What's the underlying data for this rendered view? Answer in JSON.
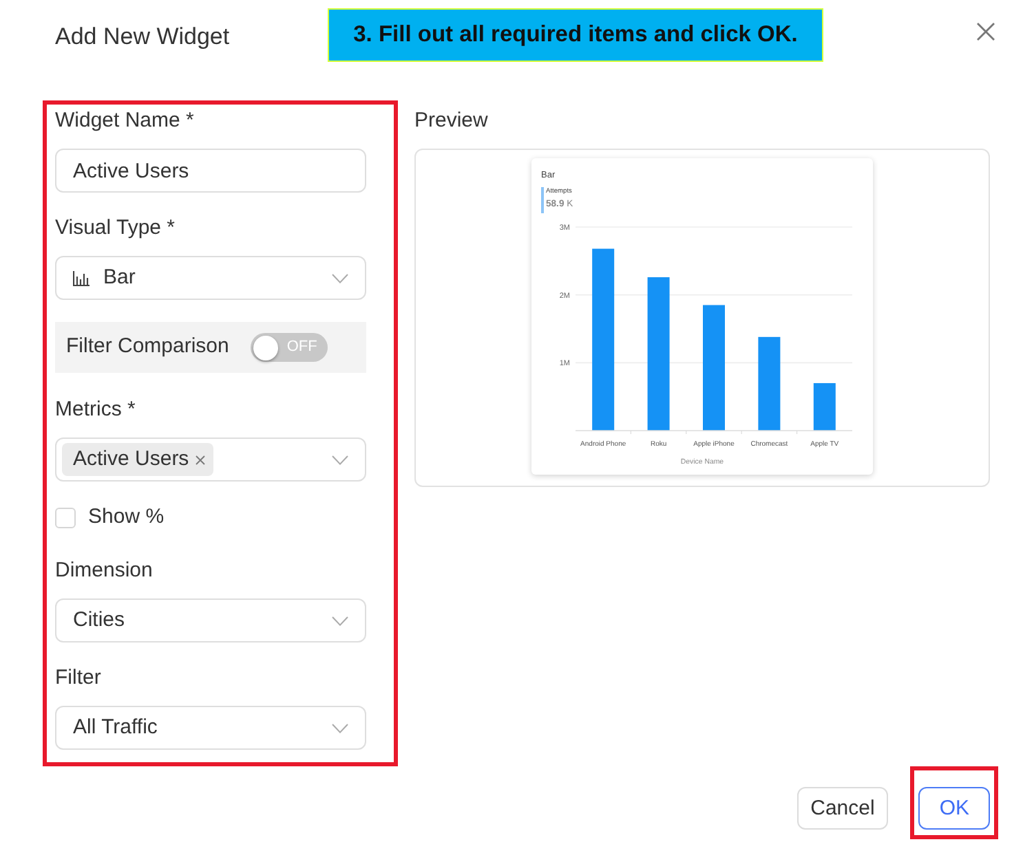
{
  "dialog": {
    "title": "Add New Widget"
  },
  "callout": {
    "text": "3. Fill out all required items and click OK."
  },
  "form": {
    "highlighted": true,
    "fields": [
      {
        "kind": "text",
        "label": "Widget Name *",
        "value": "Active Users"
      },
      {
        "kind": "visual-select",
        "label": "Visual Type *",
        "value": "Bar"
      },
      {
        "kind": "toggle",
        "label": "Filter Comparison",
        "on": false,
        "state_text": "OFF"
      },
      {
        "kind": "multi-select",
        "label": "Metrics *",
        "tags": [
          "Active Users"
        ]
      },
      {
        "kind": "checkbox",
        "label": "Show %",
        "checked": false
      },
      {
        "kind": "select",
        "label": "Dimension",
        "value": "Cities"
      },
      {
        "kind": "select",
        "label": "Filter",
        "value": "All Traffic"
      }
    ]
  },
  "preview": {
    "label": "Preview",
    "widget": {
      "metric_label": "Attempts",
      "metric_value": "**58.9** K",
      "chart_data": {
        "type": "bar",
        "title": "Bar",
        "xlabel": "Device Name",
        "categories": [
          "Android Phone",
          "Roku",
          "Apple iPhone",
          "Chromecast",
          "Apple TV"
        ],
        "values": [
          2680000,
          2260000,
          1850000,
          1380000,
          700000
        ],
        "ylim": [
          0,
          3000000
        ],
        "yticks": [
          {
            "value": 1000000,
            "label": "1M"
          },
          {
            "value": 2000000,
            "label": "2M"
          },
          {
            "value": 3000000,
            "label": "3M"
          }
        ]
      }
    }
  },
  "buttons": [
    {
      "label": "Cancel",
      "kind": "secondary",
      "highlighted": false
    },
    {
      "label": "OK",
      "kind": "primary",
      "highlighted": true
    }
  ]
}
